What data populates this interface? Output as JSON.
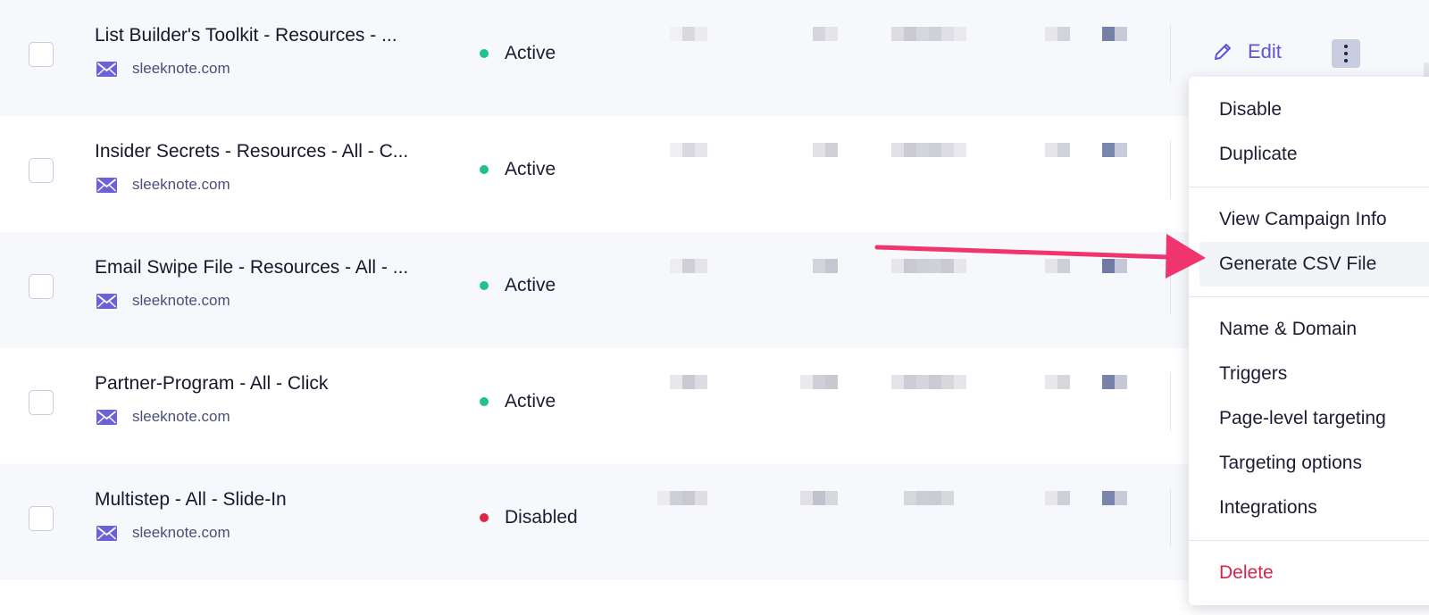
{
  "rows": [
    {
      "name": "List Builder's Toolkit - Resources - ...",
      "domain": "sleeknote.com",
      "status": "Active"
    },
    {
      "name": "Insider Secrets - Resources - All - C...",
      "domain": "sleeknote.com",
      "status": "Active"
    },
    {
      "name": "Email Swipe File - Resources - All - ...",
      "domain": "sleeknote.com",
      "status": "Active"
    },
    {
      "name": "Partner-Program - All - Click",
      "domain": "sleeknote.com",
      "status": "Active"
    },
    {
      "name": "Multistep - All - Slide-In",
      "domain": "sleeknote.com",
      "status": "Disabled"
    }
  ],
  "actions": {
    "edit_label": "Edit"
  },
  "menu": {
    "items": [
      {
        "label": "Disable"
      },
      {
        "label": "Duplicate"
      },
      {
        "label": "View Campaign Info"
      },
      {
        "label": "Generate CSV File"
      },
      {
        "label": "Name & Domain"
      },
      {
        "label": "Triggers"
      },
      {
        "label": "Page-level targeting"
      },
      {
        "label": "Targeting options"
      },
      {
        "label": "Integrations"
      },
      {
        "label": "Delete"
      }
    ]
  },
  "colors": {
    "active": "#1fc28a",
    "disabled": "#e02447",
    "accent": "#5c55d8",
    "annotation_arrow": "#f0356e",
    "danger": "#d8244a"
  },
  "icons": {
    "domain": "envelope-icon",
    "edit": "pencil-icon",
    "more": "more-vertical-icon"
  }
}
